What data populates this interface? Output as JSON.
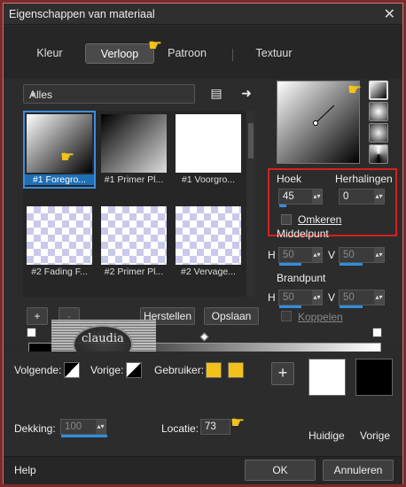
{
  "window": {
    "title": "Eigenschappen van materiaal",
    "close_glyph": "✕"
  },
  "tabs": [
    {
      "label": "Kleur"
    },
    {
      "label": "Verloop",
      "active": true
    },
    {
      "label": "Patroon"
    },
    {
      "label": "Textuur"
    }
  ],
  "library": {
    "category": "Alles",
    "thumbs": [
      {
        "label": "#1 Foregro...",
        "selected": true
      },
      {
        "label": "#1 Primer Pl..."
      },
      {
        "label": "#1 Voorgro..."
      },
      {
        "label": "#2 Fading F..."
      },
      {
        "label": "#2 Primer Pl..."
      },
      {
        "label": "#2 Vervage..."
      }
    ],
    "add_glyph": "+",
    "remove_glyph": "-",
    "reset_label": "Herstellen",
    "save_label": "Opslaan"
  },
  "settings": {
    "hoek_label": "Hoek",
    "hoek_value": "45",
    "herhalingen_label": "Herhalingen",
    "herhalingen_value": "0",
    "omkeren_label": "Omkeren",
    "middelpunt_label": "Middelpunt",
    "mid_h_label": "H",
    "mid_h_value": "50",
    "mid_v_label": "V",
    "mid_v_value": "50",
    "brandpunt_label": "Brandpunt",
    "brand_h_label": "H",
    "brand_h_value": "50",
    "brand_v_label": "V",
    "brand_v_value": "50",
    "koppelen_label": "Koppelen"
  },
  "editor": {
    "volgende_label": "Volgende:",
    "vorige_label": "Vorige:",
    "gebruiker_label": "Gebruiker:",
    "dekking_label": "Dekking:",
    "dekking_value": "100",
    "locatie_label": "Locatie:",
    "locatie_value": "73",
    "add_stop_glyph": "+",
    "huidige_label": "Huidige",
    "vorige_swatch_label": "Vorige",
    "user_color": "#f2c21b",
    "current_color": "#ffffff",
    "previous_color": "#000000"
  },
  "footer": {
    "help_label": "Help",
    "ok_label": "OK",
    "cancel_label": "Annuleren"
  },
  "watermark": {
    "text": "claudia"
  }
}
